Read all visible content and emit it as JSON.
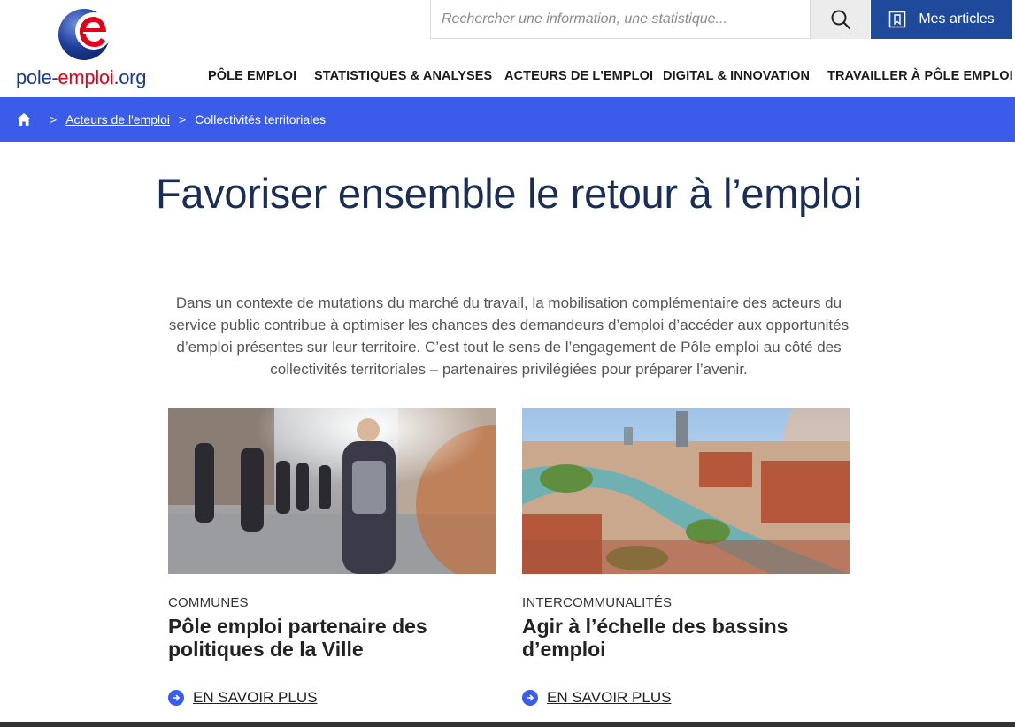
{
  "logo": {
    "part1": "pole-",
    "part2": "emploi",
    "part3": ".org",
    "letter": "e"
  },
  "search": {
    "placeholder": "Rechercher une information, une statistique..."
  },
  "mes_articles": {
    "label": "Mes articles"
  },
  "nav": {
    "items": [
      {
        "label": "PÔLE EMPLOI"
      },
      {
        "label": "STATISTIQUES & ANALYSES"
      },
      {
        "label": "ACTEURS DE L'EMPLOI"
      },
      {
        "label": "DIGITAL & INNOVATION"
      },
      {
        "label": "TRAVAILLER À PÔLE EMPLOI"
      }
    ]
  },
  "breadcrumb": {
    "sep": ">",
    "parent": "Acteurs de l'emploi",
    "current": "Collectivités territoriales"
  },
  "main": {
    "title": "Favoriser ensemble le retour à l’emploi",
    "intro": "Dans un contexte de mutations du marché du travail, la mobilisation complémentaire des acteurs du service public contribue à optimiser les chances des demandeurs d’emploi d’accéder aux opportunités d’emploi présentes sur leur territoire. C’est tout le sens de l’engagement de Pôle emploi au côté des collectivités territoriales – partenaires privilégiées pour préparer l’avenir."
  },
  "cards": [
    {
      "category": "COMMUNES",
      "title": "Pôle emploi partenaire des politiques de la Ville",
      "link": "EN SAVOIR PLUS"
    },
    {
      "category": "INTERCOMMUNALITÉS",
      "title": "Agir à l’échelle des bassins d’emploi",
      "link": "EN SAVOIR PLUS"
    }
  ],
  "colors": {
    "brand_blue": "#1f4a9c",
    "breadcrumb_blue": "#3a5ce8",
    "title_navy": "#1b2d55",
    "brand_red": "#e2001a"
  }
}
